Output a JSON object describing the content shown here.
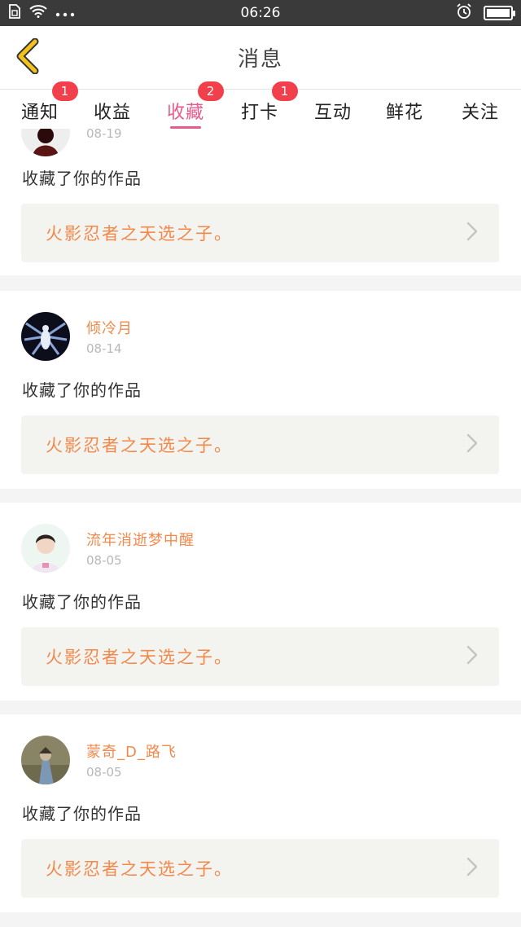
{
  "statusbar": {
    "time": "06:26"
  },
  "header": {
    "title": "消息"
  },
  "tabs": [
    {
      "label": "通知",
      "badge": "1"
    },
    {
      "label": "收益",
      "badge": ""
    },
    {
      "label": "收藏",
      "badge": "2"
    },
    {
      "label": "打卡",
      "badge": "1"
    },
    {
      "label": "互动",
      "badge": ""
    },
    {
      "label": "鲜花",
      "badge": ""
    },
    {
      "label": "关注",
      "badge": ""
    }
  ],
  "active_tab": "收藏",
  "feed": [
    {
      "username": "",
      "date": "08-19",
      "action": "收藏了你的作品",
      "work_title": "火影忍者之天选之子。"
    },
    {
      "username": "倾冷月",
      "date": "08-14",
      "action": "收藏了你的作品",
      "work_title": "火影忍者之天选之子。"
    },
    {
      "username": "流年消逝梦中醒",
      "date": "08-05",
      "action": "收藏了你的作品",
      "work_title": "火影忍者之天选之子。"
    },
    {
      "username": "蒙奇_D_路飞",
      "date": "08-05",
      "action": "收藏了你的作品",
      "work_title": "火影忍者之天选之子。"
    }
  ],
  "colors": {
    "accent": "#e85a8c",
    "orange": "#f2894b",
    "badge": "#f1404b",
    "back_arrow": "#f4c21c"
  }
}
